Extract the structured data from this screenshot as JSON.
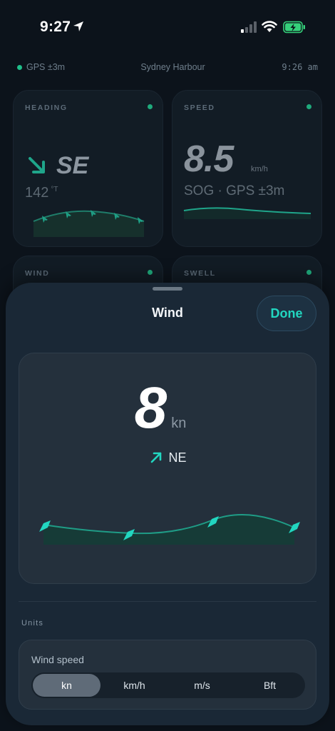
{
  "status_bar": {
    "time": "9:27"
  },
  "info_row": {
    "gps": "GPS ±3m",
    "location": "Sydney Harbour",
    "time": "9:26 am"
  },
  "cards": {
    "heading": {
      "label": "HEADING",
      "direction": "SE",
      "degrees": "142",
      "degrees_unit": "°T"
    },
    "speed": {
      "label": "SPEED",
      "value": "8.5",
      "unit": "km/h",
      "sub": "SOG · GPS ±3m"
    },
    "wind": {
      "label": "WIND"
    },
    "swell": {
      "label": "SWELL"
    }
  },
  "sheet": {
    "title": "Wind",
    "done_label": "Done",
    "value": "8",
    "unit": "kn",
    "direction": "NE",
    "units_section_label": "Units",
    "wind_speed_label": "Wind speed",
    "unit_options": [
      "kn",
      "km/h",
      "m/s",
      "Bft"
    ],
    "selected_unit": "kn"
  },
  "colors": {
    "accent": "#22d6c0",
    "background": "#0c131b",
    "sheet": "#1a2836"
  }
}
